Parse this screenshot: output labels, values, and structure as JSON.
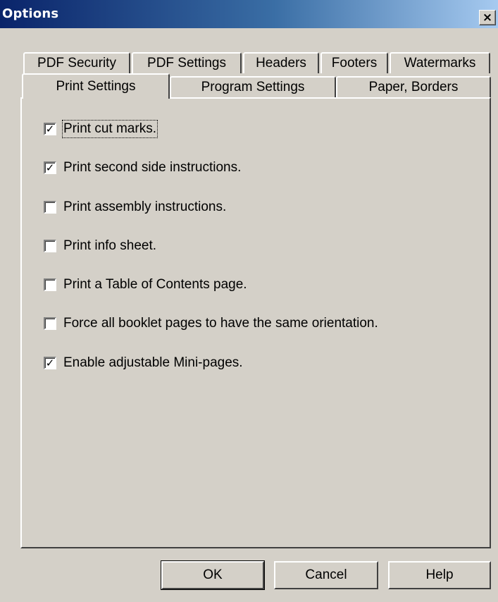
{
  "window": {
    "title": "Options",
    "close_glyph": "×"
  },
  "tabs_row1": [
    "PDF Security",
    "PDF Settings",
    "Headers",
    "Footers",
    "Watermarks"
  ],
  "tabs_row2": [
    "Print Settings",
    "Program Settings",
    "Paper, Borders"
  ],
  "active_tab": "Print Settings",
  "checkboxes": [
    {
      "label": "Print cut marks.",
      "checked": true
    },
    {
      "label": "Print second side instructions.",
      "checked": true
    },
    {
      "label": "Print assembly instructions.",
      "checked": false
    },
    {
      "label": "Print info sheet.",
      "checked": false
    },
    {
      "label": "Print a Table of Contents page.",
      "checked": false
    },
    {
      "label": "Force all booklet pages to have the same orientation.",
      "checked": false
    },
    {
      "label": "Enable adjustable Mini-pages.",
      "checked": true
    }
  ],
  "check_glyph": "✓",
  "buttons": {
    "ok": "OK",
    "cancel": "Cancel",
    "help": "Help"
  }
}
